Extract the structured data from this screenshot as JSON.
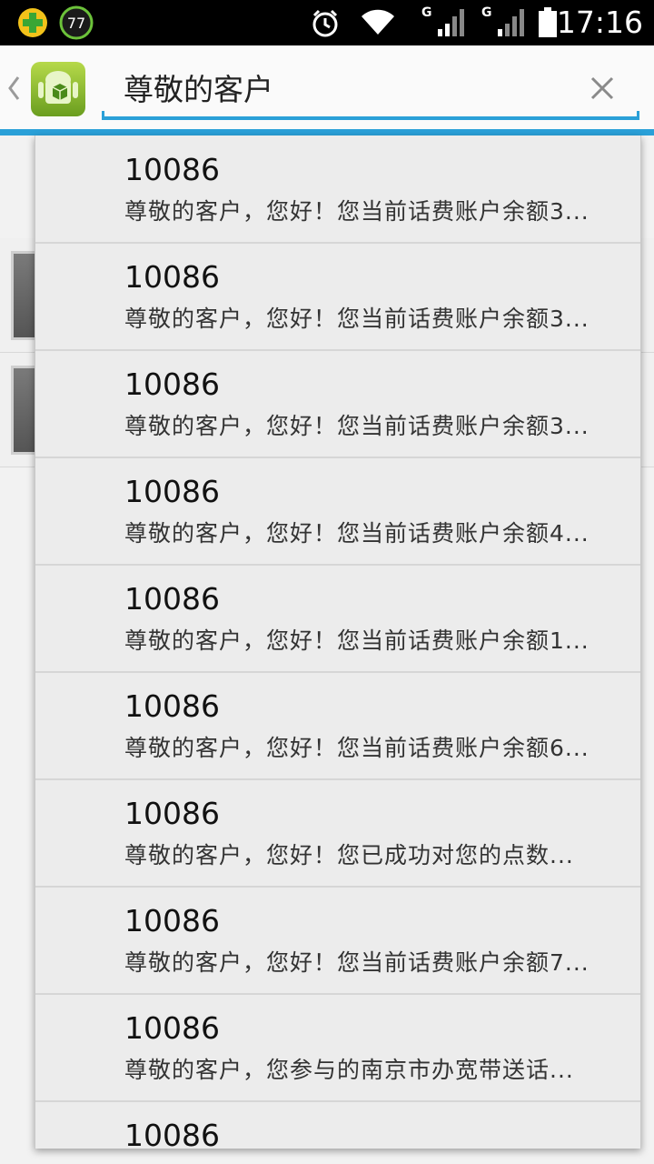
{
  "status_bar": {
    "battery_level_badge": "77",
    "network_1": "G",
    "network_2": "G",
    "time": "17:16",
    "icons": [
      "app-plus-icon",
      "security-badge-icon",
      "alarm-icon",
      "wifi-icon",
      "signal-icon",
      "signal-icon",
      "battery-icon"
    ]
  },
  "search": {
    "value": "尊敬的客户",
    "clear_icon": "close-icon",
    "app_icon": "android-app-icon",
    "back_icon": "back-caret-icon",
    "accent_color": "#2aa0d8"
  },
  "suggestions": [
    {
      "title": "10086",
      "snippet": "尊敬的客户，您好！您当前话费账户余额3..."
    },
    {
      "title": "10086",
      "snippet": "尊敬的客户，您好！您当前话费账户余额3..."
    },
    {
      "title": "10086",
      "snippet": "尊敬的客户，您好！您当前话费账户余额3..."
    },
    {
      "title": "10086",
      "snippet": "尊敬的客户，您好！您当前话费账户余额4..."
    },
    {
      "title": "10086",
      "snippet": "尊敬的客户，您好！您当前话费账户余额1..."
    },
    {
      "title": "10086",
      "snippet": "尊敬的客户，您好！您当前话费账户余额6..."
    },
    {
      "title": "10086",
      "snippet": "尊敬的客户，您好！您已成功对您的点数..."
    },
    {
      "title": "10086",
      "snippet": "尊敬的客户，您好！您当前话费账户余额7..."
    },
    {
      "title": "10086",
      "snippet": "尊敬的客户，您参与的南京市办宽带送话..."
    },
    {
      "title": "10086",
      "snippet": ""
    }
  ]
}
